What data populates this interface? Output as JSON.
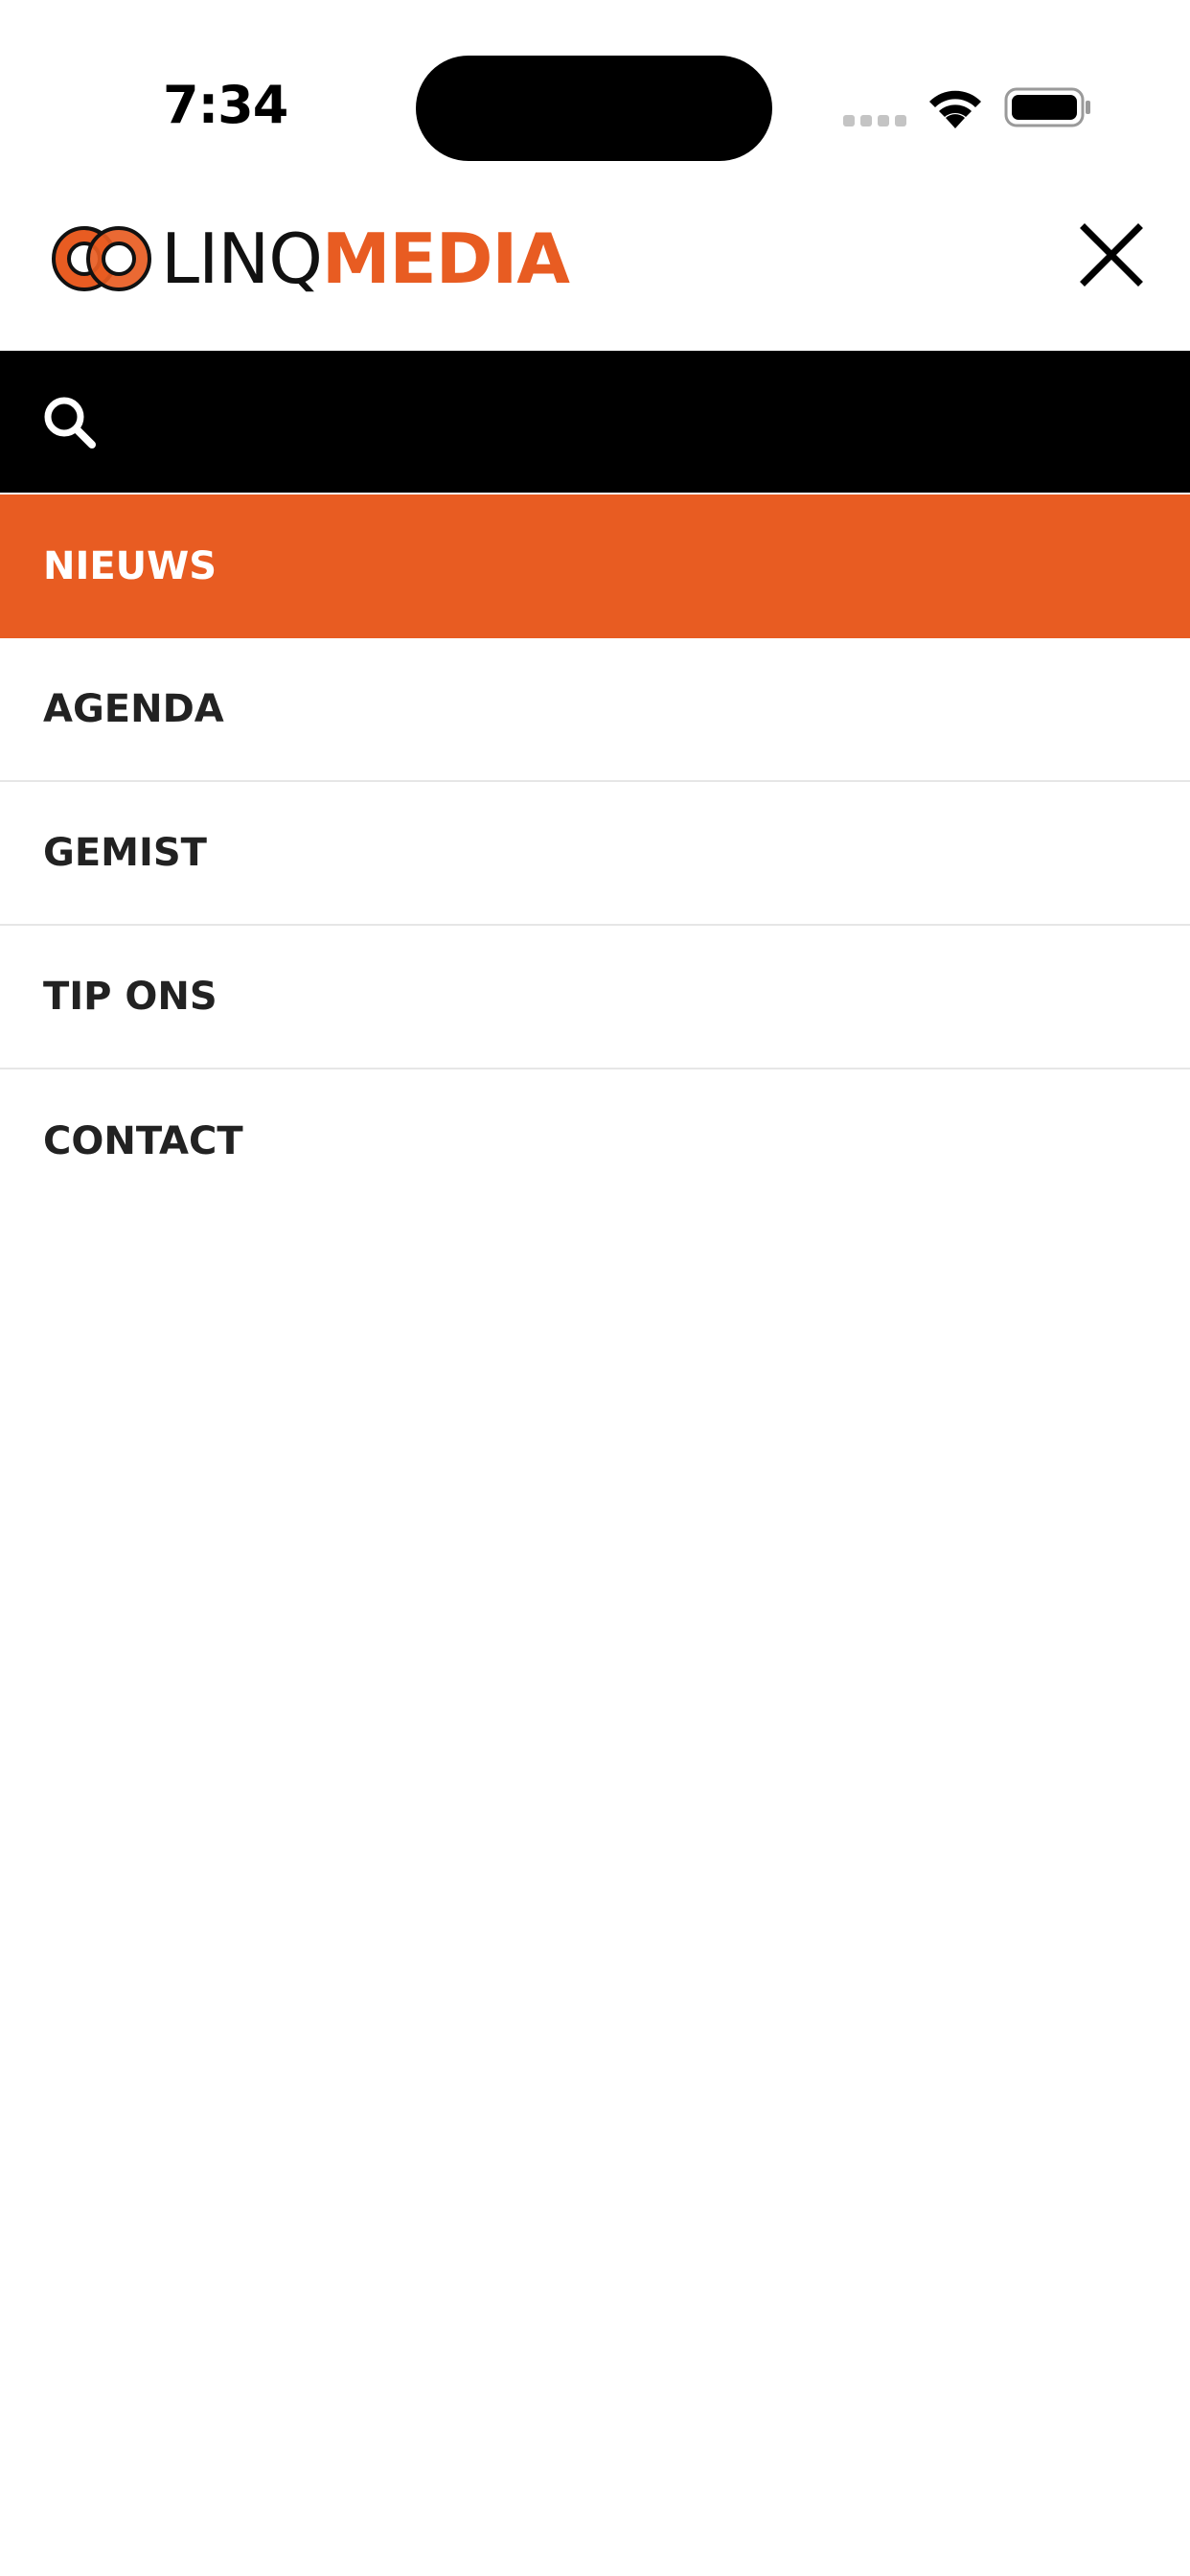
{
  "status_bar": {
    "time": "7:34"
  },
  "header": {
    "logo": {
      "word_dark": "LINQ",
      "word_accent": "MEDIA"
    },
    "close_icon": "close-icon"
  },
  "search": {
    "icon": "search-icon",
    "value": "",
    "placeholder": ""
  },
  "nav": {
    "items": [
      {
        "label": "NIEUWS",
        "active": true
      },
      {
        "label": "AGENDA",
        "active": false
      },
      {
        "label": "GEMIST",
        "active": false
      },
      {
        "label": "TIP ONS",
        "active": false
      },
      {
        "label": "CONTACT",
        "active": false
      }
    ]
  },
  "colors": {
    "accent": "#e85c22",
    "search_bar_bg": "#000000",
    "menu_text": "#222222",
    "divider": "#e6e6e6"
  }
}
